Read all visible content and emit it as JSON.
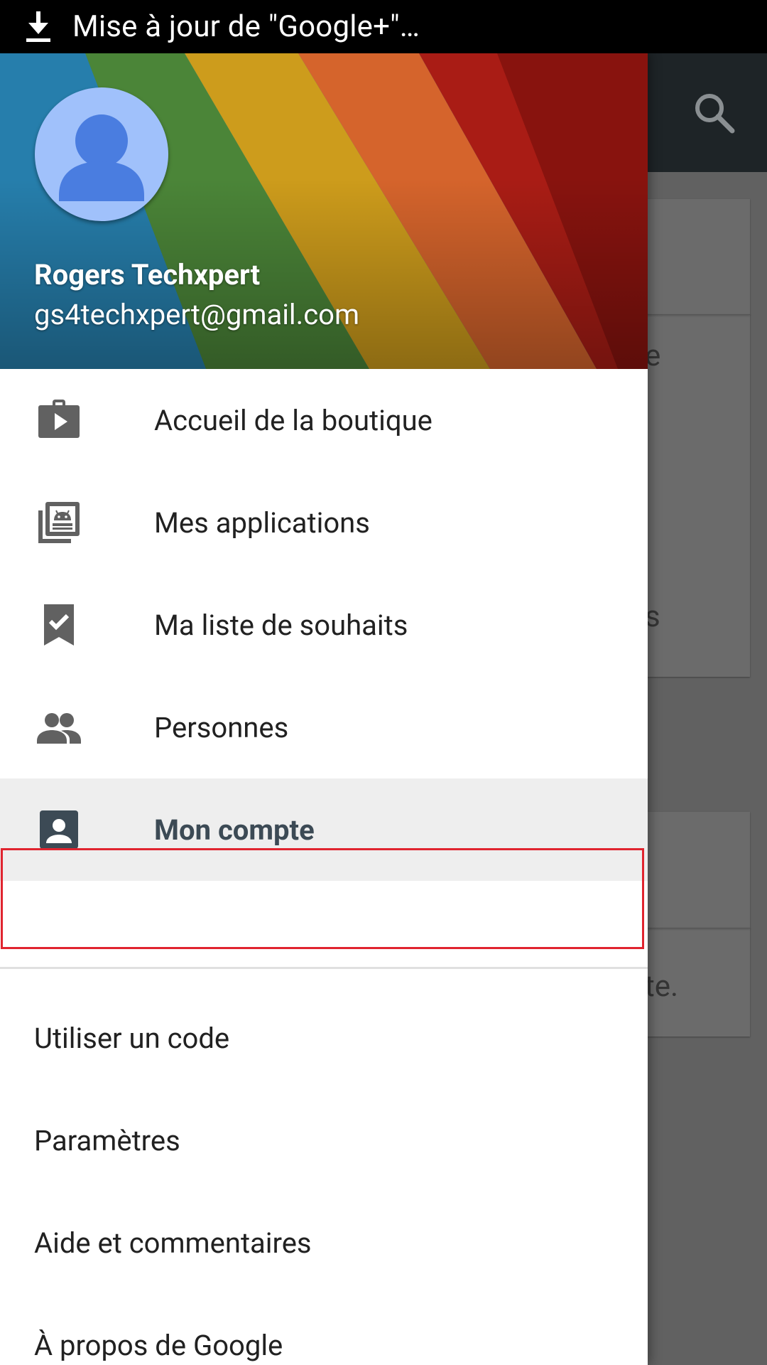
{
  "status_bar": {
    "notification_text": "Mise à jour de \"Google+\"…",
    "icon": "download-icon"
  },
  "background": {
    "search_icon": "search-icon",
    "fragments": [
      "e",
      "s",
      "te."
    ]
  },
  "drawer": {
    "account": {
      "name": "Rogers Techxpert",
      "email": "gs4techxpert@gmail.com",
      "avatar_icon": "person-avatar-icon"
    },
    "primary_items": [
      {
        "label": "Accueil de la boutique",
        "icon": "store-home-icon"
      },
      {
        "label": "Mes applications",
        "icon": "my-apps-icon"
      },
      {
        "label": "Ma liste de souhaits",
        "icon": "wishlist-icon"
      },
      {
        "label": "Personnes",
        "icon": "people-icon"
      },
      {
        "label": "Mon compte",
        "icon": "account-box-icon",
        "selected": true
      }
    ],
    "secondary_items": [
      {
        "label": "Utiliser un code"
      },
      {
        "label": "Paramètres"
      },
      {
        "label": "Aide et commentaires"
      },
      {
        "label": "À propos de Google"
      }
    ]
  },
  "colors": {
    "highlight_border": "#e0242f",
    "selected_text": "#3c4a55",
    "icon_gray": "#616161",
    "avatar_bg": "#a0c1fb",
    "avatar_fg": "#4a7de0"
  }
}
